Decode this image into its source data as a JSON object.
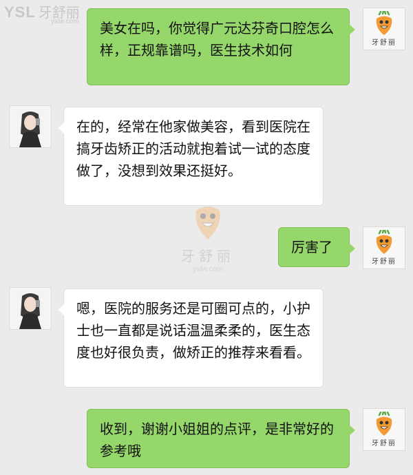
{
  "watermark": {
    "brand_latin": "YSL",
    "brand_cn": "牙舒丽",
    "url": "yslw.com"
  },
  "avatar_brand": "牙舒丽",
  "messages": [
    {
      "side": "right",
      "text": "美女在吗，你觉得广元达芬奇口腔怎么样，正规靠谱吗，医生技术如何"
    },
    {
      "side": "left",
      "text": "在的，经常在他家做美容，看到医院在搞牙齿矫正的活动就抱着试一试的态度做了，没想到效果还挺好。"
    },
    {
      "side": "right",
      "text": "厉害了"
    },
    {
      "side": "left",
      "text": "嗯，医院的服务还是可圈可点的，小护士也一直都是说话温温柔柔的，医生态度也好很负责，做矫正的推荐来看看。"
    },
    {
      "side": "right",
      "text": "收到，谢谢小姐姐的点评，是非常好的参考哦"
    }
  ],
  "colors": {
    "outgoing_bubble": "#95d76a",
    "incoming_bubble": "#ffffff",
    "background": "#ebebeb"
  }
}
